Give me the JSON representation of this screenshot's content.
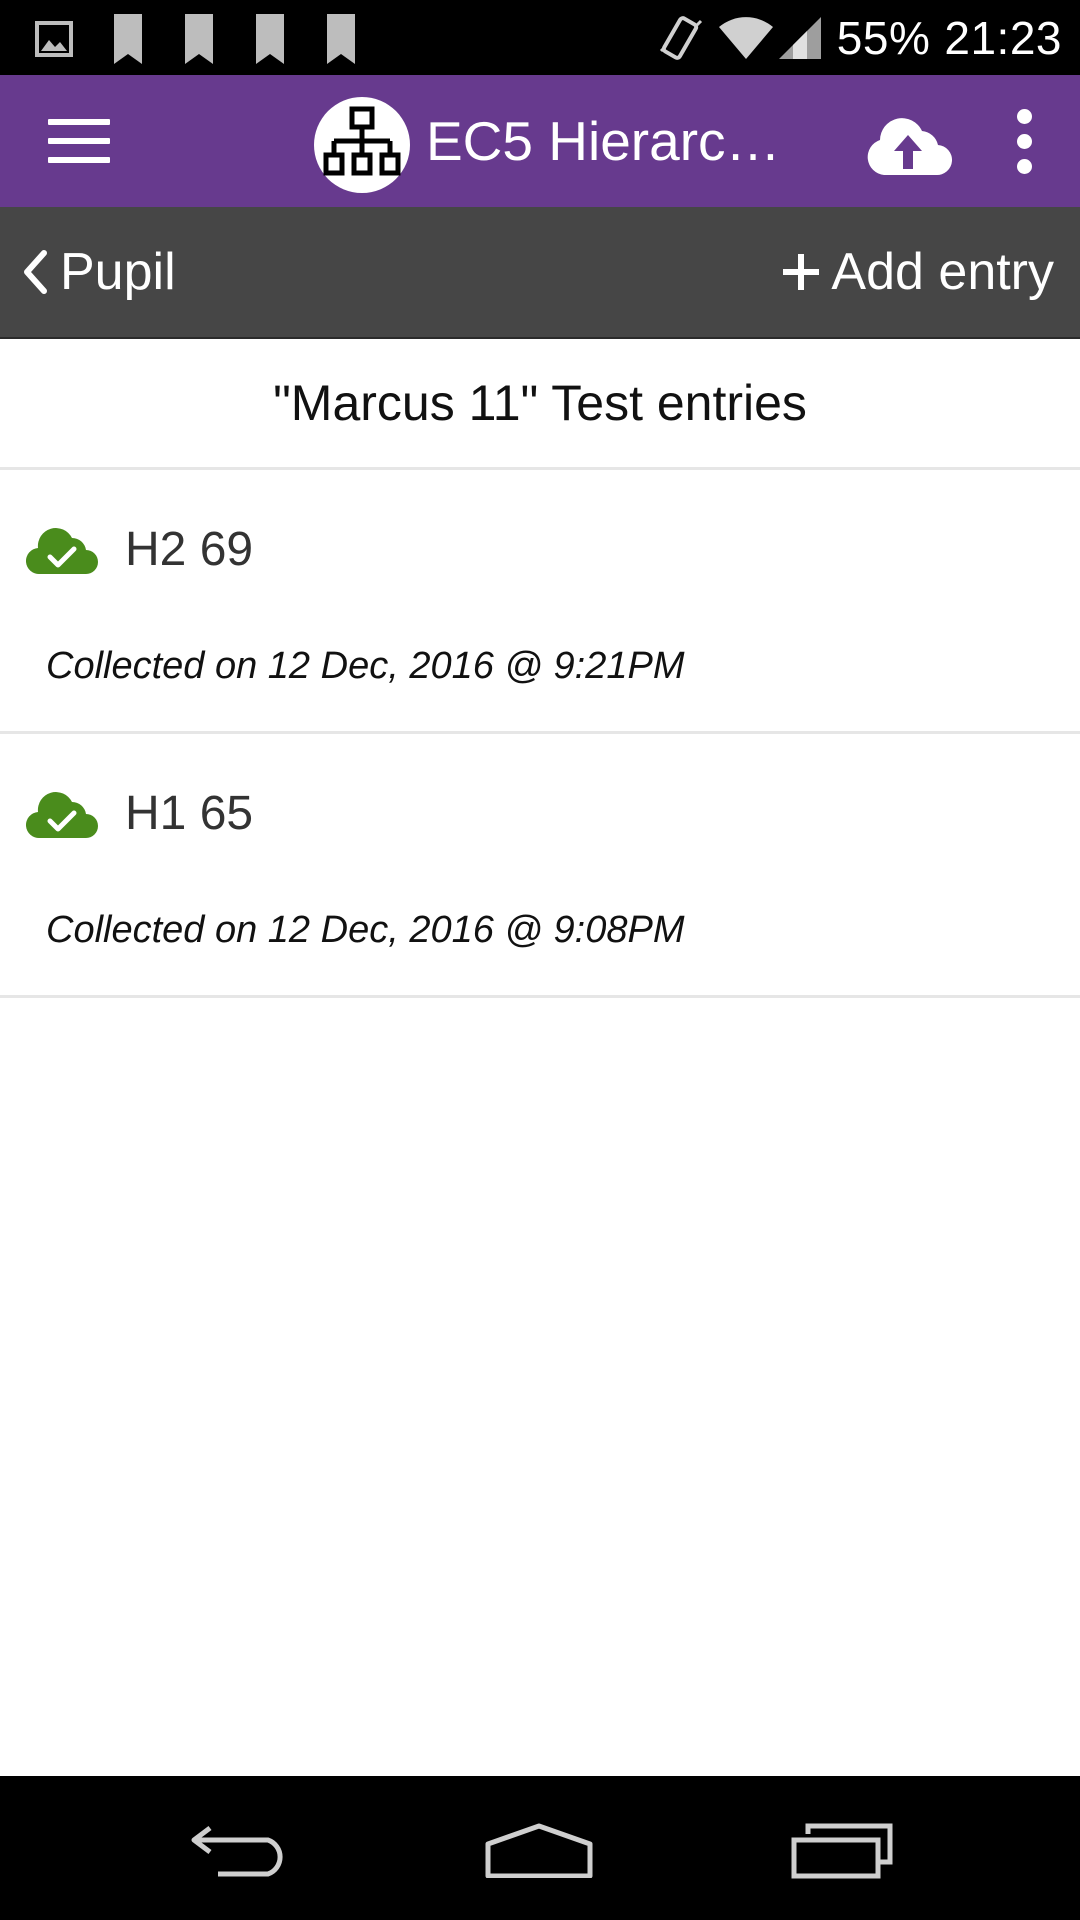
{
  "status_bar": {
    "battery": "55%",
    "time": "21:23",
    "icons": [
      "image-icon",
      "bookmark-icon",
      "bookmark-icon",
      "bookmark-icon",
      "bookmark-icon",
      "vibrate-icon",
      "wifi-icon",
      "signal-icon"
    ]
  },
  "app_bar": {
    "title": "EC5 Hierarc…",
    "icons": [
      "menu-icon",
      "hierarchy-logo-icon",
      "cloud-upload-icon",
      "more-vert-icon"
    ],
    "color": "#673a8e"
  },
  "sub_nav": {
    "back_label": "Pupil",
    "add_label": "Add entry",
    "color": "#464646"
  },
  "list": {
    "heading": "\"Marcus 11\" Test entries",
    "entries": [
      {
        "title": "H2 69",
        "date": "Collected on 12 Dec, 2016 @ 9:21PM",
        "status_icon": "cloud-check-icon"
      },
      {
        "title": "H1 65",
        "date": "Collected on 12 Dec, 2016 @ 9:08PM",
        "status_icon": "cloud-check-icon"
      }
    ],
    "synced_color": "#4a8c1c"
  },
  "nav_bar": {
    "icons": [
      "back-icon",
      "home-icon",
      "recents-icon"
    ]
  }
}
